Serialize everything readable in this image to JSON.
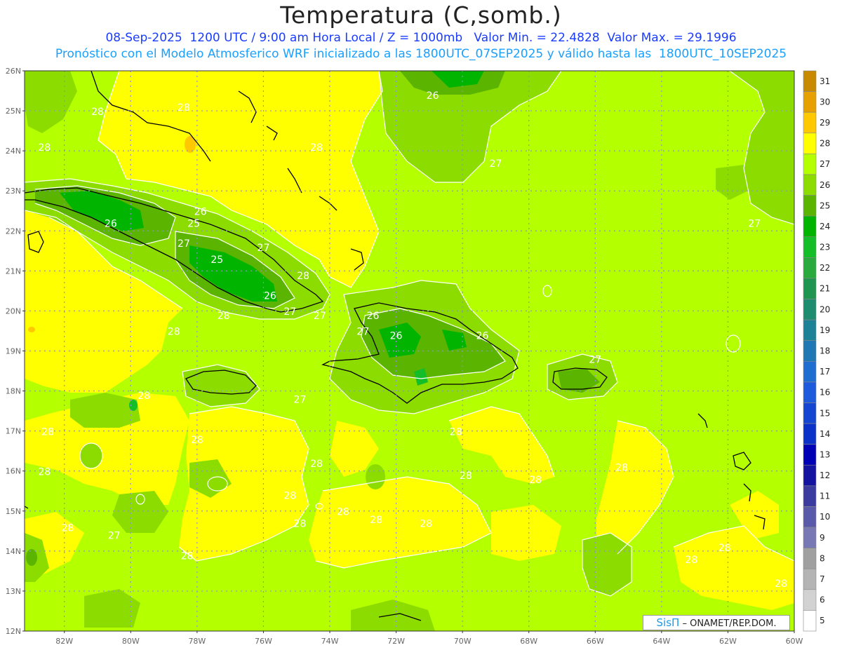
{
  "title": "Temperatura (C,somb.)",
  "subtitle_line1": "08-Sep-2025  1200 UTC / 9:00 am Hora Local / Z = 1000mb   Valor Min. = 22.4828  Valor Max. = 29.1996",
  "subtitle_line2": "Pronóstico con el Modelo Atmosferico WRF inicializado a las 1800UTC_07SEP2025 y válido hasta las  1800UTC_10SEP2025",
  "map": {
    "lat_labels": [
      "26N",
      "25N",
      "24N",
      "23N",
      "22N",
      "21N",
      "20N",
      "19N",
      "18N",
      "17N",
      "16N",
      "15N",
      "14N",
      "13N",
      "12N"
    ],
    "lat_values": [
      26,
      25,
      24,
      23,
      22,
      21,
      20,
      19,
      18,
      17,
      16,
      15,
      14,
      13,
      12
    ],
    "lon_labels": [
      "82W",
      "80W",
      "78W",
      "76W",
      "74W",
      "72W",
      "70W",
      "68W",
      "66W",
      "64W",
      "62W",
      "60W"
    ],
    "lon_values": [
      -82,
      -80,
      -78,
      -76,
      -74,
      -72,
      -70,
      -68,
      -66,
      -64,
      -62,
      -60
    ],
    "lat_range": [
      12,
      26
    ],
    "lon_range": [
      -83.2,
      -60
    ],
    "grid": "dotted",
    "contour_labels": [
      {
        "text": "26",
        "lon": -70.9,
        "lat": 25.3
      },
      {
        "text": "27",
        "lon": -69.0,
        "lat": 23.6
      },
      {
        "text": "27",
        "lon": -61.2,
        "lat": 22.1
      },
      {
        "text": "28",
        "lon": -74.4,
        "lat": 24.0
      },
      {
        "text": "28",
        "lon": -81.0,
        "lat": 24.9
      },
      {
        "text": "28",
        "lon": -82.6,
        "lat": 24.0
      },
      {
        "text": "28",
        "lon": -78.4,
        "lat": 25.0
      },
      {
        "text": "25",
        "lon": -78.1,
        "lat": 22.1
      },
      {
        "text": "26",
        "lon": -77.9,
        "lat": 22.4
      },
      {
        "text": "26",
        "lon": -80.6,
        "lat": 22.1
      },
      {
        "text": "27",
        "lon": -78.4,
        "lat": 21.6
      },
      {
        "text": "27",
        "lon": -76.0,
        "lat": 21.5
      },
      {
        "text": "25",
        "lon": -77.4,
        "lat": 21.2
      },
      {
        "text": "26",
        "lon": -75.8,
        "lat": 20.3
      },
      {
        "text": "28",
        "lon": -74.8,
        "lat": 20.8
      },
      {
        "text": "28",
        "lon": -77.2,
        "lat": 19.8
      },
      {
        "text": "28",
        "lon": -78.7,
        "lat": 19.4
      },
      {
        "text": "27",
        "lon": -75.2,
        "lat": 19.9
      },
      {
        "text": "27",
        "lon": -74.3,
        "lat": 19.8
      },
      {
        "text": "26",
        "lon": -72.7,
        "lat": 19.8
      },
      {
        "text": "27",
        "lon": -73.0,
        "lat": 19.4
      },
      {
        "text": "26",
        "lon": -72.0,
        "lat": 19.3
      },
      {
        "text": "26",
        "lon": -69.4,
        "lat": 19.3
      },
      {
        "text": "27",
        "lon": -66.0,
        "lat": 18.7
      },
      {
        "text": "28",
        "lon": -79.6,
        "lat": 17.8
      },
      {
        "text": "27",
        "lon": -74.9,
        "lat": 17.7
      },
      {
        "text": "28",
        "lon": -82.5,
        "lat": 16.9
      },
      {
        "text": "28",
        "lon": -78.0,
        "lat": 16.7
      },
      {
        "text": "28",
        "lon": -70.2,
        "lat": 16.9
      },
      {
        "text": "28",
        "lon": -74.4,
        "lat": 16.1
      },
      {
        "text": "28",
        "lon": -69.9,
        "lat": 15.8
      },
      {
        "text": "28",
        "lon": -67.8,
        "lat": 15.7
      },
      {
        "text": "28",
        "lon": -65.2,
        "lat": 16.0
      },
      {
        "text": "28",
        "lon": -82.6,
        "lat": 15.9
      },
      {
        "text": "28",
        "lon": -75.2,
        "lat": 15.3
      },
      {
        "text": "28",
        "lon": -73.6,
        "lat": 14.9
      },
      {
        "text": "28",
        "lon": -72.6,
        "lat": 14.7
      },
      {
        "text": "28",
        "lon": -71.1,
        "lat": 14.6
      },
      {
        "text": "28",
        "lon": -74.9,
        "lat": 14.6
      },
      {
        "text": "28",
        "lon": -81.9,
        "lat": 14.5
      },
      {
        "text": "27",
        "lon": -80.5,
        "lat": 14.3
      },
      {
        "text": "28",
        "lon": -78.3,
        "lat": 13.8
      },
      {
        "text": "28",
        "lon": -63.1,
        "lat": 13.7
      },
      {
        "text": "28",
        "lon": -62.1,
        "lat": 14.0
      },
      {
        "text": "28",
        "lon": -60.4,
        "lat": 13.1
      }
    ]
  },
  "colorbar": {
    "labels": [
      "31",
      "30",
      "29",
      "28",
      "27",
      "26",
      "25",
      "24",
      "23",
      "22",
      "21",
      "20",
      "19",
      "18",
      "17",
      "16",
      "15",
      "14",
      "13",
      "12",
      "11",
      "10",
      "9",
      "8",
      "7",
      "6",
      "5"
    ],
    "colors": [
      "#c88a00",
      "#e6a000",
      "#ffc800",
      "#ffff00",
      "#b4ff00",
      "#8cdc00",
      "#5ab400",
      "#00b400",
      "#14be28",
      "#28aa3c",
      "#1e9650",
      "#1e8c6e",
      "#1e8296",
      "#1e78b4",
      "#1e6ed2",
      "#1e5adc",
      "#1446d2",
      "#0a32c8",
      "#0000b4",
      "#1414a0",
      "#3c3ca0",
      "#5a5aaa",
      "#7878b4",
      "#a0a0a0",
      "#b4b4b4",
      "#d2d2d2",
      "#ffffff"
    ],
    "min": 5,
    "max": 31
  },
  "colors": {
    "t29": "#ffc800",
    "t28": "#ffff00",
    "t27": "#b4ff00",
    "t26": "#8cdc00",
    "t25": "#5ab400",
    "t24": "#00b400",
    "t23": "#14be28",
    "contour": "#ffffff",
    "coast": "#000000",
    "grid": "#9090c8"
  },
  "credit": {
    "brand": "SisΠ",
    "text": "– ONAMET/REP.DOM."
  }
}
